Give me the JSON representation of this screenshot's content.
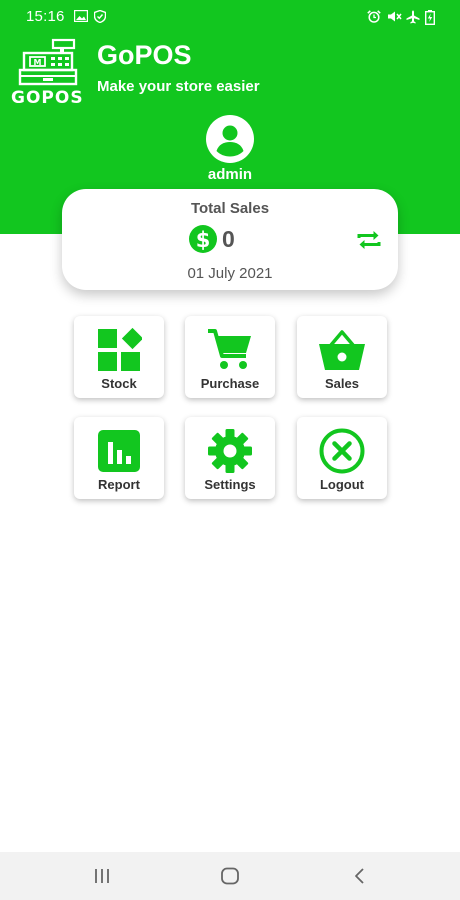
{
  "status_bar": {
    "time": "15:16",
    "left_icons": [
      "image-icon",
      "shield-icon"
    ],
    "right_icons": [
      "alarm-icon",
      "mute-icon",
      "airplane-icon",
      "battery-charging-icon"
    ]
  },
  "header": {
    "logo_text": "GOPOS",
    "title": "GoPOS",
    "subtitle": "Make your store easier",
    "user_name": "admin"
  },
  "sales_card": {
    "title": "Total Sales",
    "value": "0",
    "date": "01 July 2021"
  },
  "menu": {
    "stock": "Stock",
    "purchase": "Purchase",
    "sales": "Sales",
    "report": "Report",
    "settings": "Settings",
    "logout": "Logout"
  },
  "colors": {
    "accent": "#12c61f",
    "nav_bar": "#f2f2f2"
  }
}
